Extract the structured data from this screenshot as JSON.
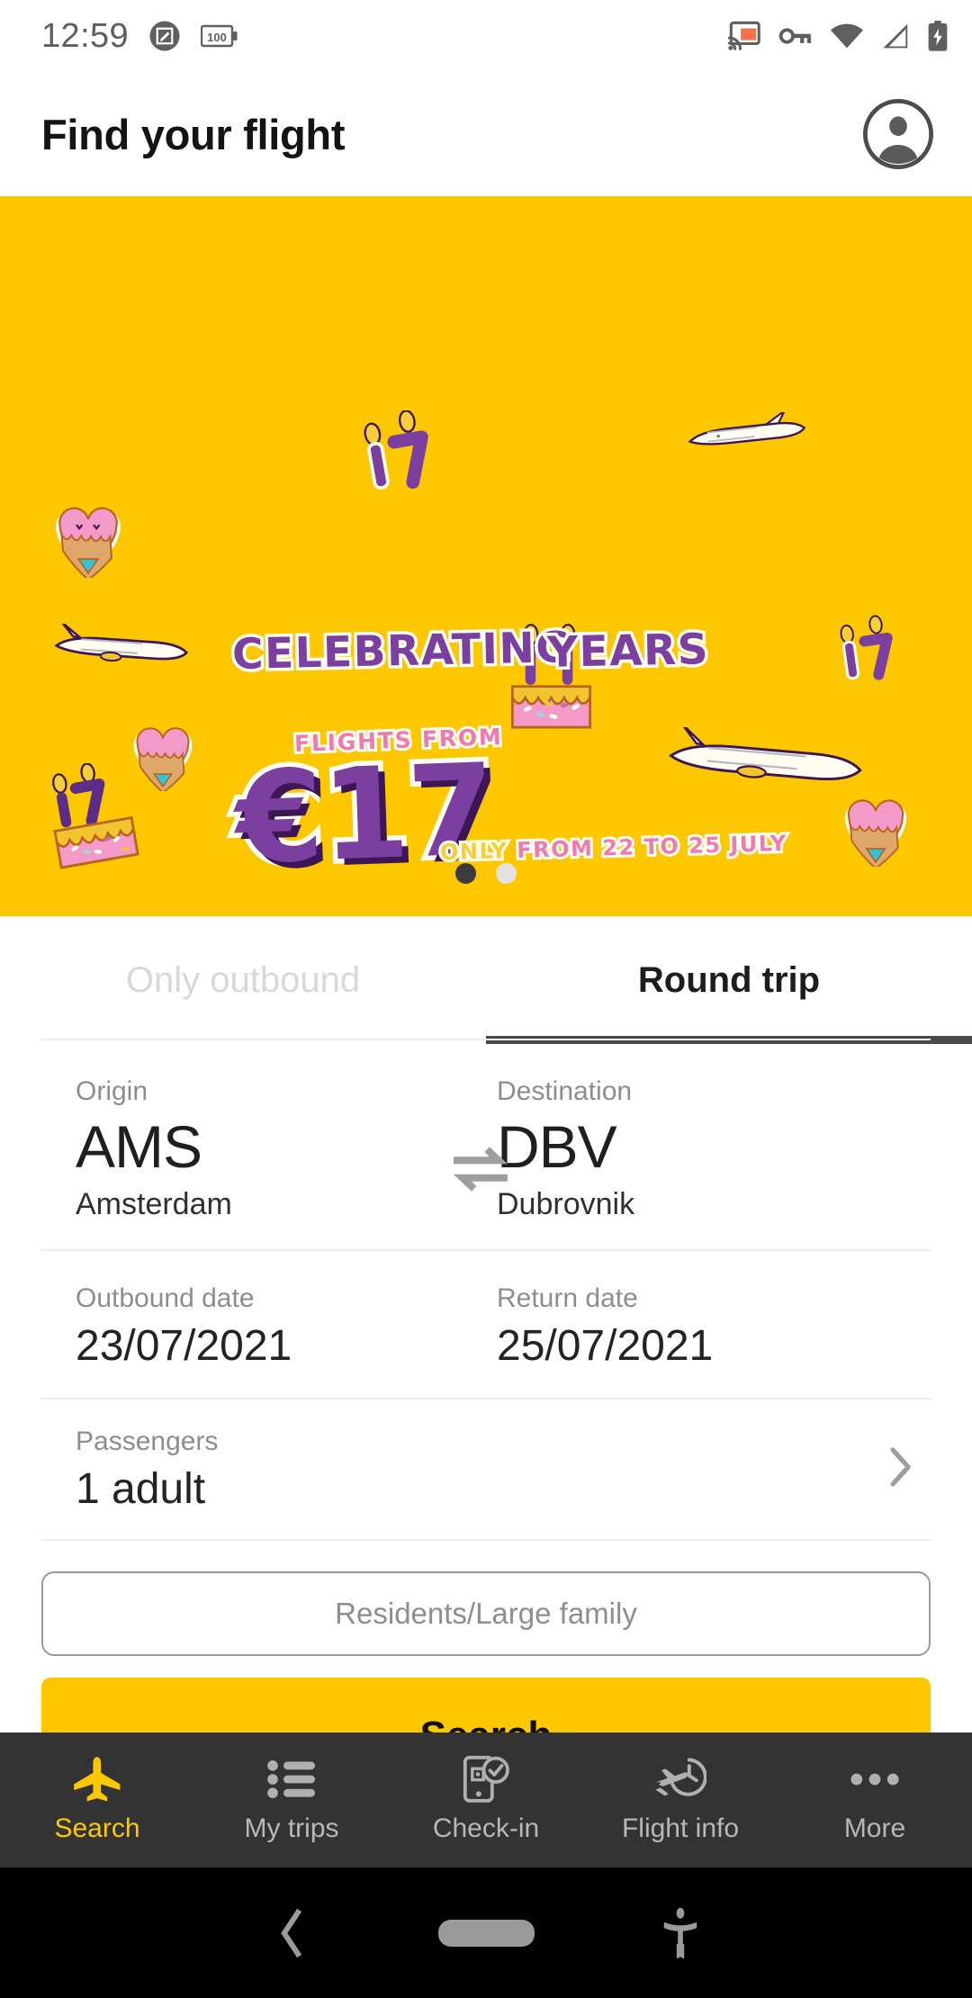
{
  "status_bar": {
    "time": "12:59",
    "left_icons": [
      "screenshot-edit-icon",
      "battery-100-icon"
    ],
    "battery_text": "100",
    "right_icons": [
      "cast-icon",
      "vpn-key-icon",
      "wifi-icon",
      "cellular-signal-icon",
      "battery-charging-icon"
    ],
    "cast_accent_color": "#f4714a",
    "icon_color": "#5f5f5f"
  },
  "app_bar": {
    "title": "Find your flight",
    "account_icon": "account-circle-icon"
  },
  "banner": {
    "background_color": "#fdc800",
    "headline_prefix": "CELEBRATING",
    "headline_number": "17",
    "headline_suffix": "YEARS",
    "flights_from": "FLIGHTS FROM",
    "price": "€17",
    "validity": "ONLY FROM 22 TO 25 JULY",
    "validity_first_word": "ONLY",
    "validity_rest": "FROM 22 TO 25 JULY",
    "purple": "#7b3fa0",
    "pink": "#ef7ab0",
    "candle_yellow": "#f4cf3a",
    "stickers": [
      "candles-17-sticker",
      "ice-cream-heart-sticker",
      "birthday-cake-sticker",
      "airplane-sticker"
    ],
    "carousel": {
      "total": 2,
      "active_index": 0
    }
  },
  "trip_tabs": [
    {
      "label": "Only outbound",
      "active": false
    },
    {
      "label": "Round trip",
      "active": true
    }
  ],
  "search_form": {
    "origin": {
      "label": "Origin",
      "code": "AMS",
      "city": "Amsterdam"
    },
    "destination": {
      "label": "Destination",
      "code": "DBV",
      "city": "Dubrovnik"
    },
    "swap_icon": "swap-horizontal-icon",
    "outbound": {
      "label": "Outbound date",
      "value": "23/07/2021"
    },
    "return": {
      "label": "Return date",
      "value": "25/07/2021"
    },
    "passengers": {
      "label": "Passengers",
      "value": "1 adult",
      "chevron_icon": "chevron-right-icon"
    },
    "residents": {
      "placeholder": "Residents/Large family",
      "value": ""
    },
    "search_button": {
      "label": "Search",
      "color": "#fdc800"
    }
  },
  "bottom_nav": [
    {
      "label": "Search",
      "icon": "airplane-icon",
      "active": true
    },
    {
      "label": "My trips",
      "icon": "list-icon",
      "active": false
    },
    {
      "label": "Check-in",
      "icon": "mobile-check-icon",
      "active": false
    },
    {
      "label": "Flight info",
      "icon": "plane-clock-icon",
      "active": false
    },
    {
      "label": "More",
      "icon": "more-horizontal-icon",
      "active": false
    }
  ],
  "system_nav": {
    "back_icon": "back-chevron-icon",
    "home_icon": "home-pill-icon",
    "accessibility_icon": "accessibility-icon"
  }
}
